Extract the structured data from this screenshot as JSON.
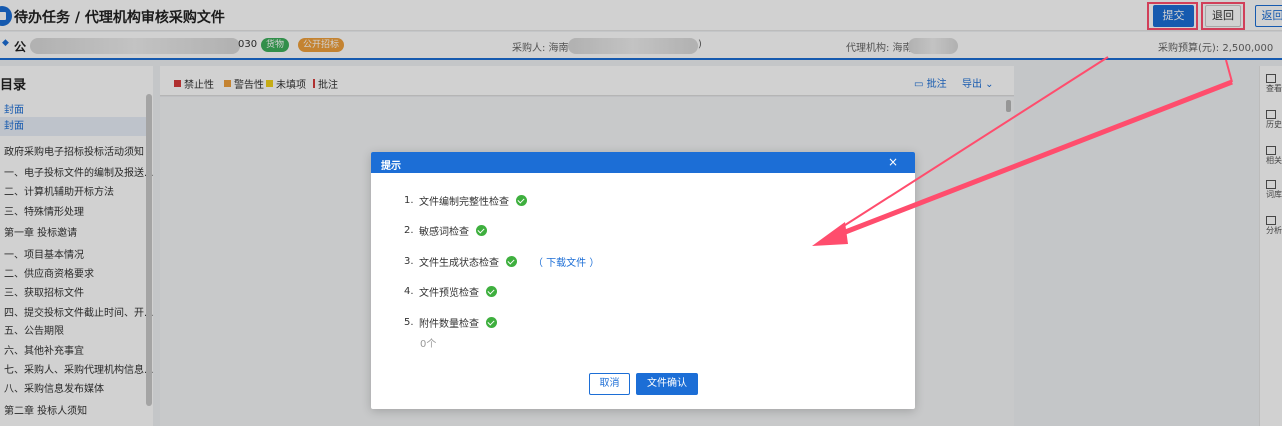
{
  "header": {
    "title": "待办任务 / 代理机构审核采购文件",
    "submit_label": "提交",
    "return_label": "退回",
    "back_label": "返回"
  },
  "info": {
    "project_prefix": "公",
    "project_suffix": "030",
    "tag_goods": "货物",
    "tag_bidding": "公开招标",
    "purchaser_label": "采购人: 海南",
    "purchaser_suffix": ")",
    "agency_label": "代理机构: 海南",
    "budget_label": "采购预算(元): 2,500,000"
  },
  "sidebar": {
    "title": "目录",
    "items": [
      "封面",
      "封面",
      "政府采购电子招标投标活动须知",
      "一、电子投标文件的编制及报送...",
      "二、计算机辅助开标方法",
      "三、特殊情形处理",
      "第一章 投标邀请",
      "一、项目基本情况",
      "二、供应商资格要求",
      "三、获取招标文件",
      "四、提交投标文件截止时间、开...",
      "五、公告期限",
      "六、其他补充事宜",
      "七、采购人、采购代理机构信息...",
      "八、采购信息发布媒体",
      "第二章 投标人须知"
    ]
  },
  "doc_toolbar": {
    "legend": [
      "禁止性",
      "警告性",
      "未填项",
      "批注"
    ],
    "legend_colors": [
      "#d73b3b",
      "#f0a03c",
      "#f2d21b",
      "#d73b3b"
    ],
    "annotate_label": "批注",
    "export_label": "导出"
  },
  "right_tools": [
    "查看",
    "历史",
    "相关",
    "词库",
    "分析"
  ],
  "modal": {
    "title": "提示",
    "close": "×",
    "checks": [
      {
        "num": "1.",
        "label": "文件编制完整性检查"
      },
      {
        "num": "2.",
        "label": "敏感词检查"
      },
      {
        "num": "3.",
        "label": "文件生成状态检查",
        "link": "（ 下载文件 ）"
      },
      {
        "num": "4.",
        "label": "文件预览检查"
      },
      {
        "num": "5.",
        "label": "附件数量检查"
      }
    ],
    "count": "0个",
    "cancel_label": "取消",
    "confirm_label": "文件确认"
  },
  "colors": {
    "primary": "#1c6ed6",
    "success": "#3eaf3e",
    "annotation": "#ff4d6d"
  }
}
